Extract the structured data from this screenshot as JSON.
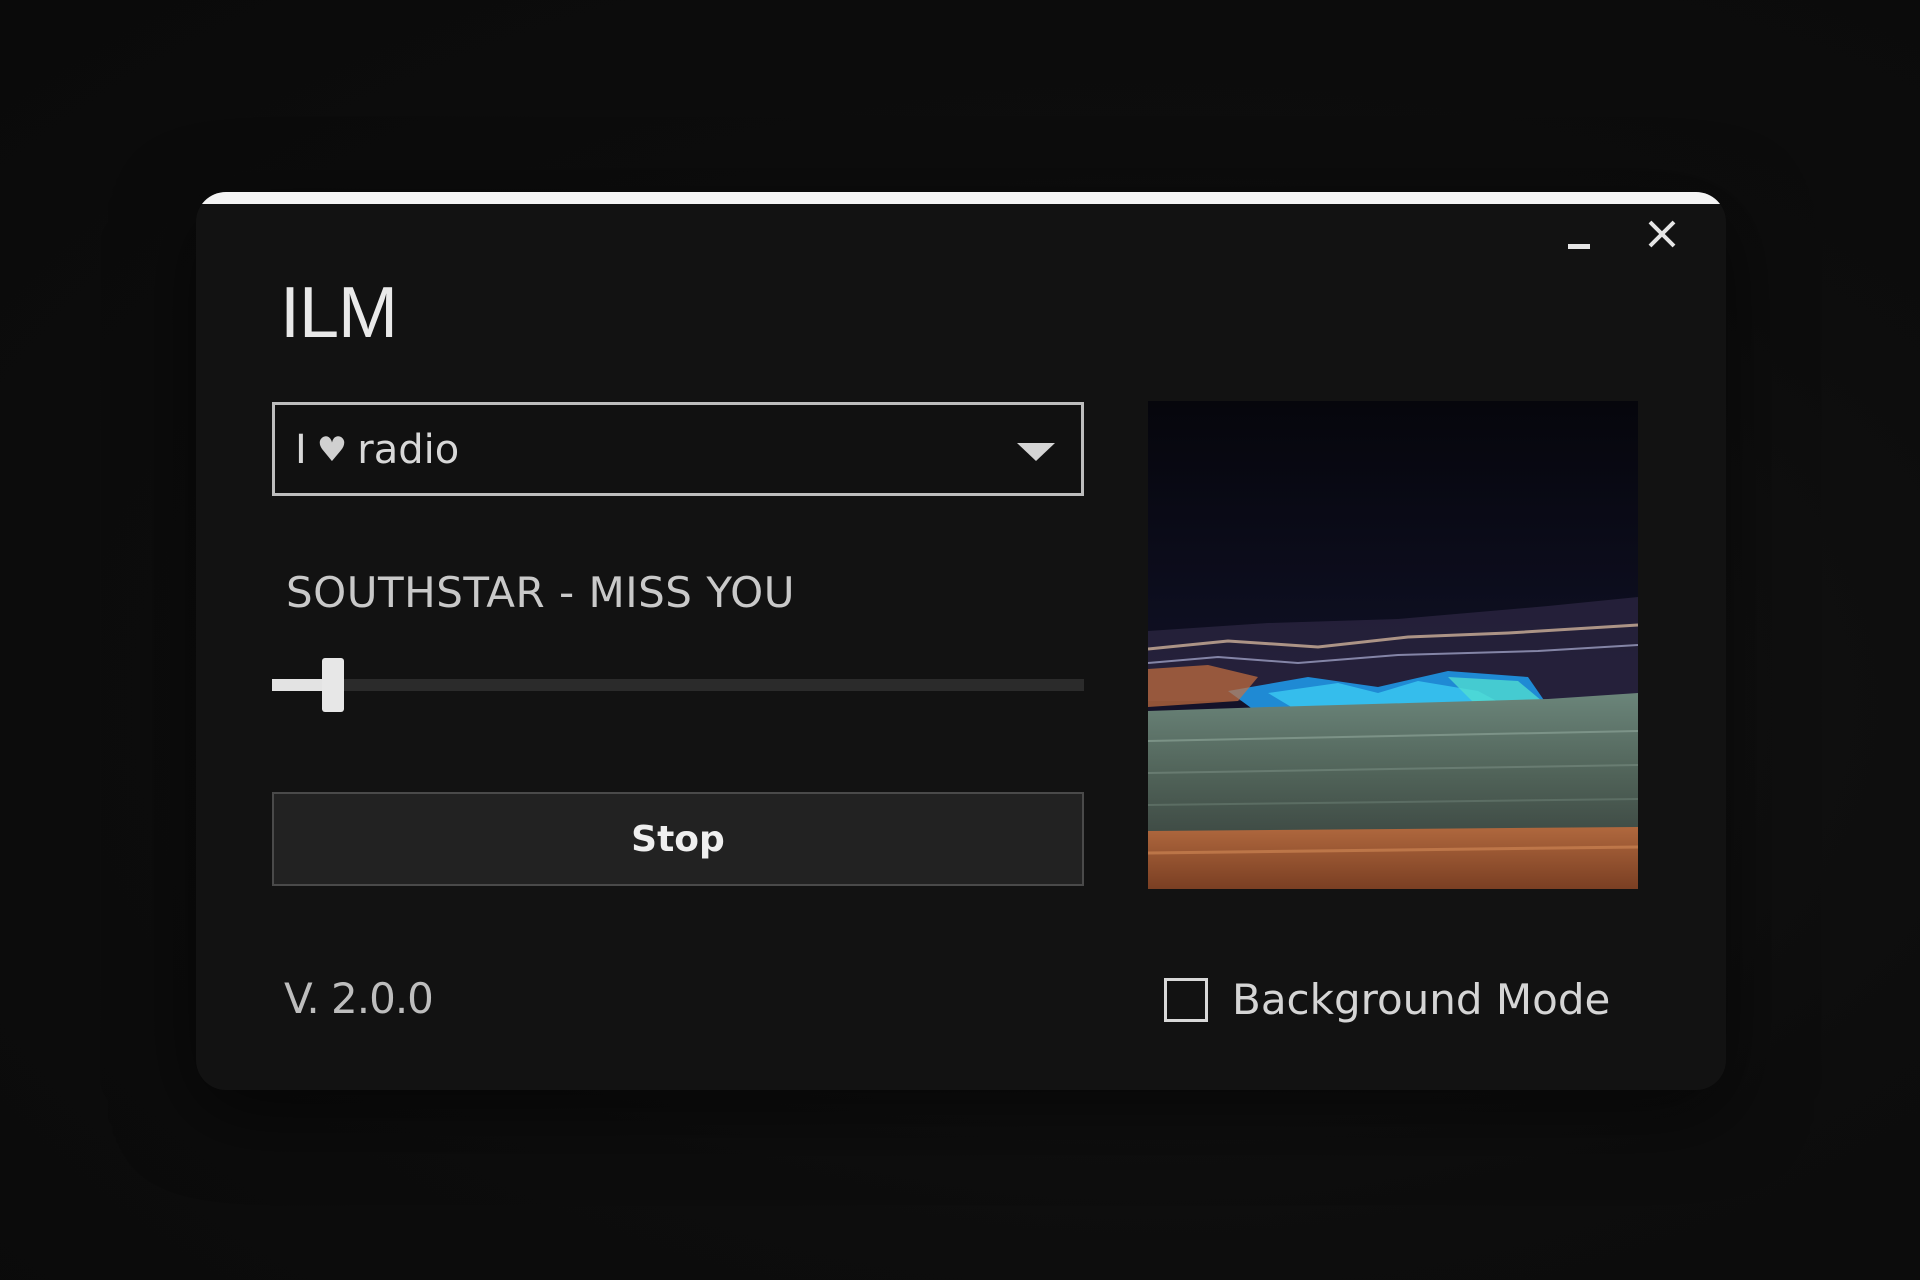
{
  "window": {
    "title": "ILM",
    "controls": {
      "minimize_icon": "minimize-icon",
      "close_icon": "close-icon"
    }
  },
  "station": {
    "prefix": "I",
    "heart_icon": "heart-icon",
    "name": "radio",
    "dropdown_icon": "chevron-down-icon"
  },
  "now_playing": {
    "track": "SOUTHSTAR - MISS YOU"
  },
  "volume": {
    "level": 0.04
  },
  "player": {
    "stop_label": "Stop"
  },
  "footer": {
    "version": "V. 2.0.0",
    "background_mode_label": "Background Mode",
    "background_mode_checked": false
  },
  "colors": {
    "background": "#0b0b0b",
    "window": "#121212",
    "accent_white": "#f4f4f4",
    "button": "#222222"
  }
}
